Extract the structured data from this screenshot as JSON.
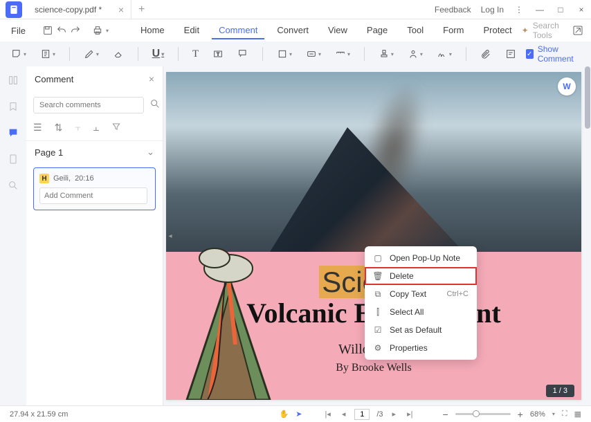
{
  "tab": {
    "title": "science-copy.pdf *"
  },
  "title_right": {
    "feedback": "Feedback",
    "login": "Log In"
  },
  "file_menu": "File",
  "menu": {
    "items": [
      "Home",
      "Edit",
      "Comment",
      "Convert",
      "View",
      "Page",
      "Tool",
      "Form",
      "Protect"
    ],
    "active_index": 2
  },
  "search_tools_placeholder": "Search Tools",
  "show_comment_label": "Show Comment",
  "comment_panel": {
    "title": "Comment",
    "search_placeholder": "Search comments",
    "page_label": "Page 1",
    "comment": {
      "badge": "H",
      "author": "Geili,",
      "time": "20:16",
      "add_placeholder": "Add Comment"
    }
  },
  "document": {
    "heading1_highlighted": "Scienc",
    "heading1_rest": "e",
    "heading2": "Volcanic E               nt",
    "subtitle1": "Willow Cree",
    "subtitle2": "By Brooke Wells",
    "word_badge": "W"
  },
  "context_menu": {
    "items": [
      {
        "label": "Open Pop-Up Note",
        "shortcut": ""
      },
      {
        "label": "Delete",
        "shortcut": ""
      },
      {
        "label": "Copy Text",
        "shortcut": "Ctrl+C"
      },
      {
        "label": "Select All",
        "shortcut": ""
      },
      {
        "label": "Set as Default",
        "shortcut": ""
      },
      {
        "label": "Properties",
        "shortcut": ""
      }
    ],
    "highlighted_index": 1
  },
  "page_indicator": "1 / 3",
  "statusbar": {
    "dimensions": "27.94 x 21.59 cm",
    "current_page": "1",
    "total_pages": "/3",
    "zoom": "68%"
  }
}
